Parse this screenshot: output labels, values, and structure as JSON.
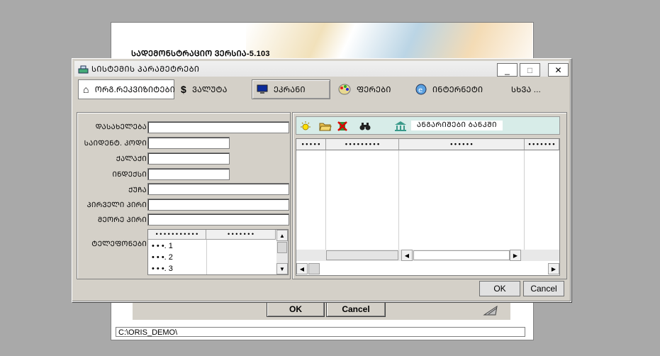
{
  "splash": {
    "version": "ᲡᲐᲓᲔᲛᲝᲜᲡᲢᲠᲐᲪᲘᲝ ᲕᲔᲠᲡᲘᲐ-5.103",
    "ok_label": "OK",
    "cancel_label": "Cancel",
    "path": "C:\\ORIS_DEMO\\"
  },
  "dialog": {
    "title": "ᲡᲘᲡᲢᲔᲛᲘᲡ ᲞᲐᲠᲐᲛᲔᲢᲠᲔᲑᲘ",
    "window_buttons": {
      "minimize": "_",
      "maximize": "□",
      "close": "✕"
    },
    "tabs": [
      {
        "label": "ᲝᲠᲒ.ᲠᲔᲙᲕᲘᲖᲘᲢᲔᲑᲘ",
        "icon": "house-icon"
      },
      {
        "label": "ᲕᲐᲚᲣᲢᲐ",
        "icon": "currency-icon"
      },
      {
        "label": "ᲔᲙᲠᲐᲜᲘ",
        "icon": "monitor-icon"
      },
      {
        "label": "ᲤᲔᲠᲔᲑᲘ",
        "icon": "palette-icon"
      },
      {
        "label": "ᲘᲜᲢᲔᲠᲜᲔᲢᲘ",
        "icon": "internet-icon"
      },
      {
        "label": "ᲡᲮᲕᲐ ..."
      }
    ],
    "form": {
      "name_label": "ᲓᲐᲡᲐᲮᲔᲚᲔᲑᲐ",
      "tax_code_label": "ᲡᲐᲘᲓᲔᲜᲢ. ᲙᲝᲓᲘ",
      "city_label": "ᲥᲐᲚᲐᲥᲘ",
      "index_label": "ᲘᲜᲓᲔᲥᲡᲘ",
      "street_label": "ᲥᲣᲩᲐ",
      "first_person_label": "ᲞᲘᲠᲕᲔᲚᲘ ᲞᲘᲠᲘ",
      "second_person_label": "ᲛᲔᲝᲠᲔ ᲞᲘᲠᲘ",
      "phones_label": "ᲢᲔᲚᲔᲤᲝᲜᲔᲑᲘ",
      "phones_columns": [
        "• • • • • • • • • • •",
        "• • • • • • •"
      ],
      "phones_rows": [
        "• • •. 1",
        "• • •. 2",
        "• • •. 3"
      ]
    },
    "banks": {
      "label": "ᲐᲜᲒᲐᲠᲘᲨᲔᲑᲘ ᲑᲐᲜᲙᲨᲘ",
      "columns": [
        "• • • • •",
        "• • • • • • • • •",
        "• • • • • •",
        "• • • • • • •"
      ]
    },
    "ok_label": "OK",
    "cancel_label": "Cancel"
  }
}
